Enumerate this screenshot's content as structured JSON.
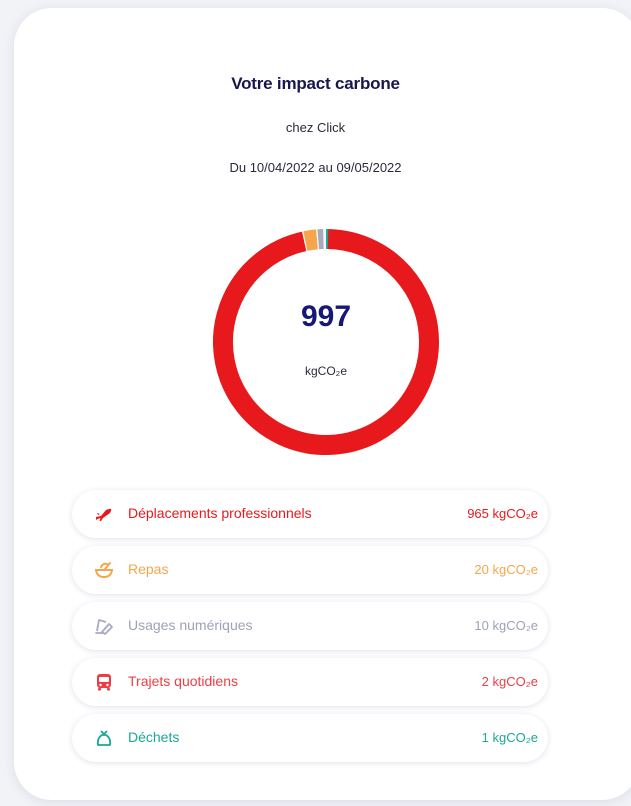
{
  "header": {
    "title": "Votre impact carbone",
    "company": "chez Click",
    "period": "Du 10/04/2022 au 09/05/2022"
  },
  "total": {
    "value": "997",
    "unit": "kgCO₂e"
  },
  "categories": [
    {
      "label": "Déplacements professionnels",
      "value_text": "965 kgCO₂e",
      "value": 965,
      "color": "#e8191d",
      "icon": "airplane-icon"
    },
    {
      "label": "Repas",
      "value_text": "20 kgCO₂e",
      "value": 20,
      "color": "#f7a54a",
      "icon": "meal-bowl-icon"
    },
    {
      "label": "Usages numériques",
      "value_text": "10 kgCO₂e",
      "value": 10,
      "color": "#a6abbf",
      "icon": "devices-icon"
    },
    {
      "label": "Trajets quotidiens",
      "value_text": "2 kgCO₂e",
      "value": 2,
      "color": "#ef3d46",
      "icon": "bus-icon"
    },
    {
      "label": "Déchets",
      "value_text": "1 kgCO₂e",
      "value": 1,
      "color": "#1aa897",
      "icon": "trash-bag-icon"
    }
  ],
  "chart_data": {
    "type": "pie",
    "categories": [
      "Déplacements professionnels",
      "Repas",
      "Usages numériques",
      "Trajets quotidiens",
      "Déchets"
    ],
    "values": [
      965,
      20,
      10,
      2,
      1
    ],
    "colors": [
      "#e8191d",
      "#f7a54a",
      "#a6abbf",
      "#ef3d46",
      "#1aa897"
    ]
  }
}
